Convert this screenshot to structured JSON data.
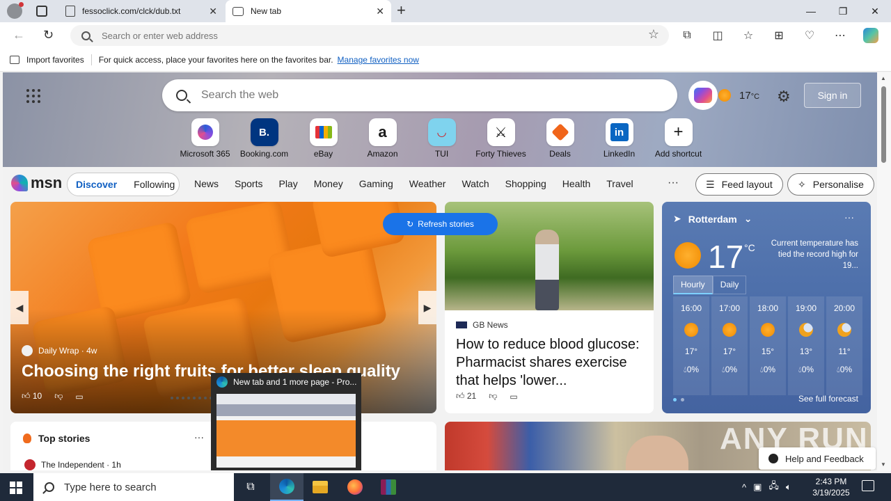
{
  "browser": {
    "tabs": [
      {
        "label": "fessoclick.com/clck/dub.txt"
      },
      {
        "label": "New tab"
      }
    ],
    "address": {
      "placeholder": "Search or enter web address"
    },
    "favorites_bar": {
      "import": "Import favorites",
      "message": "For quick access, place your favorites here on the favorites bar.",
      "manage_link": "Manage favorites now"
    }
  },
  "msn": {
    "search_placeholder": "Search the web",
    "top_temp": "17",
    "top_unit": "°C",
    "sign_in": "Sign in",
    "shortcuts": [
      {
        "label": "Microsoft 365",
        "glyph": ""
      },
      {
        "label": "Booking.com",
        "glyph": "B."
      },
      {
        "label": "eBay",
        "glyph": ""
      },
      {
        "label": "Amazon",
        "glyph": "a"
      },
      {
        "label": "TUI",
        "glyph": ""
      },
      {
        "label": "Forty Thieves",
        "glyph": ""
      },
      {
        "label": "Deals",
        "glyph": ""
      },
      {
        "label": "LinkedIn",
        "glyph": "in"
      },
      {
        "label": "Add shortcut",
        "glyph": "+"
      }
    ],
    "logo": "msn",
    "feed_tabs": [
      "Discover",
      "Following"
    ],
    "categories": [
      "News",
      "Sports",
      "Play",
      "Money",
      "Gaming",
      "Weather",
      "Watch",
      "Shopping",
      "Health",
      "Travel"
    ],
    "more": "···",
    "feed_layout": "Feed layout",
    "personalise": "Personalise",
    "refresh": "Refresh stories",
    "hero": {
      "source": "Daily Wrap · 4w",
      "title": "Choosing the right fruits for better sleep quality",
      "likes": "10"
    },
    "news": {
      "source": "GB News",
      "title": "How to reduce blood glucose: Pharmacist shares exercise that helps 'lower...",
      "likes": "21"
    },
    "weather": {
      "location": "Rotterdam",
      "temp": "17",
      "unit": "°C",
      "alert": "Current temperature has tied the record high for 19...",
      "tabs": [
        "Hourly",
        "Daily"
      ],
      "hours": [
        {
          "time": "16:00",
          "temp": "17°",
          "precip": "0%",
          "icon": "sun"
        },
        {
          "time": "17:00",
          "temp": "17°",
          "precip": "0%",
          "icon": "sun"
        },
        {
          "time": "18:00",
          "temp": "15°",
          "precip": "0%",
          "icon": "sun"
        },
        {
          "time": "19:00",
          "temp": "13°",
          "precip": "0%",
          "icon": "moon"
        },
        {
          "time": "20:00",
          "temp": "11°",
          "precip": "0%",
          "icon": "moon"
        }
      ],
      "see_full": "See full forecast"
    },
    "top_stories": {
      "title": "Top stories",
      "more": "···",
      "source": "The Independent · 1h"
    },
    "help": "Help and Feedback",
    "watermark": "ANY RUN"
  },
  "thumbnail": {
    "title": "New tab and 1 more page - Pro..."
  },
  "taskbar": {
    "search_placeholder": "Type here to search",
    "time": "2:43 PM",
    "date": "3/19/2025"
  }
}
